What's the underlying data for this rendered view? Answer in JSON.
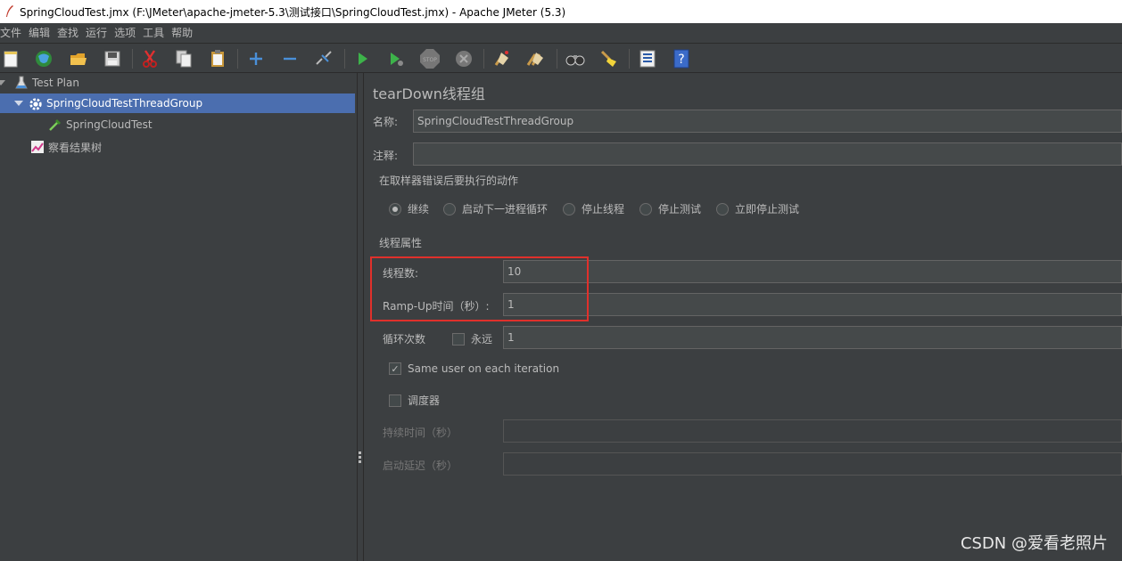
{
  "window": {
    "title": "SpringCloudTest.jmx (F:\\JMeter\\apache-jmeter-5.3\\测试接口\\SpringCloudTest.jmx) - Apache JMeter (5.3)"
  },
  "menu": [
    "文件",
    "编辑",
    "查找",
    "运行",
    "选项",
    "工具",
    "帮助"
  ],
  "toolbar": [
    "new-icon",
    "templates-icon",
    "open-icon",
    "save-icon",
    "cut-icon",
    "copy-icon",
    "paste-icon",
    "expand-icon",
    "collapse-icon",
    "toggle-icon",
    "start-icon",
    "start-no-pause-icon",
    "stop-icon",
    "shutdown-icon",
    "clear-icon",
    "clear-all-icon",
    "search-icon",
    "reset-search-icon",
    "function-helper-icon",
    "help-icon"
  ],
  "tree": {
    "test_plan": "Test Plan",
    "thread_group": "SpringCloudTestThreadGroup",
    "sampler": "SpringCloudTest",
    "listener": "察看结果树"
  },
  "panel": {
    "title": "tearDown线程组",
    "name_label": "名称:",
    "name_value": "SpringCloudTestThreadGroup",
    "comment_label": "注释:",
    "comment_value": "",
    "error_action": {
      "title": "在取样器错误后要执行的动作",
      "options": [
        "继续",
        "启动下一进程循环",
        "停止线程",
        "停止测试",
        "立即停止测试"
      ],
      "selected": "继续"
    },
    "thread_props": {
      "title": "线程属性",
      "threads_label": "线程数:",
      "threads_value": "10",
      "rampup_label": "Ramp-Up时间（秒）:",
      "rampup_value": "1",
      "loop_label": "循环次数",
      "forever_label": "永远",
      "forever_checked": false,
      "loop_value": "1",
      "same_user_label": "Same user on each iteration",
      "same_user_checked": true,
      "scheduler_label": "调度器",
      "scheduler_checked": false,
      "duration_label": "持续时间（秒）",
      "duration_value": "",
      "delay_label": "启动延迟（秒）",
      "delay_value": ""
    }
  },
  "watermark": "CSDN @爱看老照片",
  "colors": {
    "background": "#3c3f41",
    "selection": "#4b6eaf",
    "highlight_box": "#e0302b"
  }
}
